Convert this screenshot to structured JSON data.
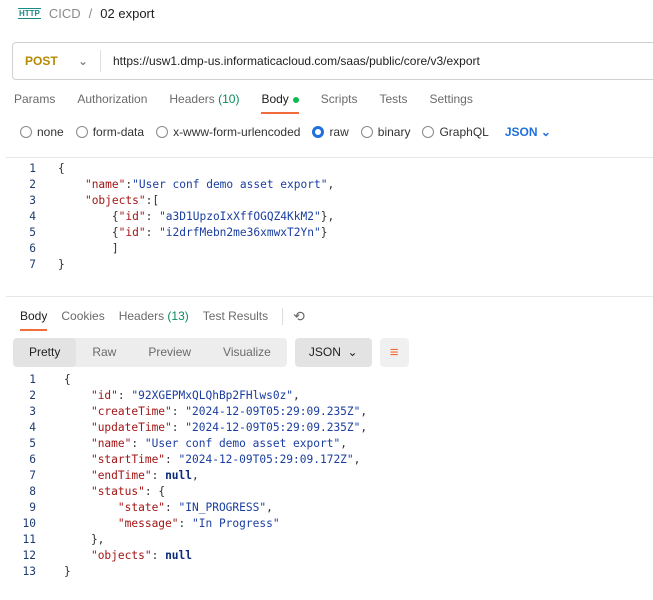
{
  "breadcrumb": {
    "icon": "HTTP",
    "parent": "CICD",
    "separator": "/",
    "current": "02 export"
  },
  "request": {
    "method": "POST",
    "url": "https://usw1.dmp-us.informaticacloud.com/saas/public/core/v3/export"
  },
  "tabs": [
    {
      "label": "Params"
    },
    {
      "label": "Authorization"
    },
    {
      "label": "Headers",
      "count": "(10)"
    },
    {
      "label": "Body"
    },
    {
      "label": "Scripts"
    },
    {
      "label": "Tests"
    },
    {
      "label": "Settings"
    }
  ],
  "body_types": [
    {
      "label": "none",
      "selected": false
    },
    {
      "label": "form-data",
      "selected": false
    },
    {
      "label": "x-www-form-urlencoded",
      "selected": false
    },
    {
      "label": "raw",
      "selected": true
    },
    {
      "label": "binary",
      "selected": false
    },
    {
      "label": "GraphQL",
      "selected": false
    }
  ],
  "body_format": "JSON",
  "request_body": [
    [
      [
        "pn",
        "{"
      ]
    ],
    [
      [
        "pn",
        "    "
      ],
      [
        "k",
        "\"name\""
      ],
      [
        "pn",
        ":"
      ],
      [
        "s",
        "\"User conf demo asset export\""
      ],
      [
        "pn",
        ","
      ]
    ],
    [
      [
        "pn",
        "    "
      ],
      [
        "k",
        "\"objects\""
      ],
      [
        "pn",
        ":["
      ]
    ],
    [
      [
        "pn",
        "        {"
      ],
      [
        "k",
        "\"id\""
      ],
      [
        "pn",
        ": "
      ],
      [
        "s",
        "\"a3D1UpzoIxXffOGQZ4KkM2\""
      ],
      [
        "pn",
        "},"
      ]
    ],
    [
      [
        "pn",
        "        {"
      ],
      [
        "k",
        "\"id\""
      ],
      [
        "pn",
        ": "
      ],
      [
        "s",
        "\"i2drfMebn2me36xmwxT2Yn\""
      ],
      [
        "pn",
        "}"
      ]
    ],
    [
      [
        "pn",
        "        ]"
      ]
    ],
    [
      [
        "pn",
        "}"
      ]
    ]
  ],
  "response_tabs": [
    {
      "label": "Body"
    },
    {
      "label": "Cookies"
    },
    {
      "label": "Headers",
      "count": "(13)"
    },
    {
      "label": "Test Results"
    }
  ],
  "view_modes": [
    "Pretty",
    "Raw",
    "Preview",
    "Visualize"
  ],
  "response_format": "JSON",
  "response_body": [
    [
      [
        "pn",
        "{"
      ]
    ],
    [
      [
        "pn",
        "    "
      ],
      [
        "k",
        "\"id\""
      ],
      [
        "pn",
        ": "
      ],
      [
        "s",
        "\"92XGEPMxQLQhBp2FHlws0z\""
      ],
      [
        "pn",
        ","
      ]
    ],
    [
      [
        "pn",
        "    "
      ],
      [
        "k",
        "\"createTime\""
      ],
      [
        "pn",
        ": "
      ],
      [
        "s",
        "\"2024-12-09T05:29:09.235Z\""
      ],
      [
        "pn",
        ","
      ]
    ],
    [
      [
        "pn",
        "    "
      ],
      [
        "k",
        "\"updateTime\""
      ],
      [
        "pn",
        ": "
      ],
      [
        "s",
        "\"2024-12-09T05:29:09.235Z\""
      ],
      [
        "pn",
        ","
      ]
    ],
    [
      [
        "pn",
        "    "
      ],
      [
        "k",
        "\"name\""
      ],
      [
        "pn",
        ": "
      ],
      [
        "s",
        "\"User conf demo asset export\""
      ],
      [
        "pn",
        ","
      ]
    ],
    [
      [
        "pn",
        "    "
      ],
      [
        "k",
        "\"startTime\""
      ],
      [
        "pn",
        ": "
      ],
      [
        "s",
        "\"2024-12-09T05:29:09.172Z\""
      ],
      [
        "pn",
        ","
      ]
    ],
    [
      [
        "pn",
        "    "
      ],
      [
        "k",
        "\"endTime\""
      ],
      [
        "pn",
        ": "
      ],
      [
        "n",
        "null"
      ],
      [
        "pn",
        ","
      ]
    ],
    [
      [
        "pn",
        "    "
      ],
      [
        "k",
        "\"status\""
      ],
      [
        "pn",
        ": {"
      ]
    ],
    [
      [
        "pn",
        "        "
      ],
      [
        "k",
        "\"state\""
      ],
      [
        "pn",
        ": "
      ],
      [
        "s",
        "\"IN_PROGRESS\""
      ],
      [
        "pn",
        ","
      ]
    ],
    [
      [
        "pn",
        "        "
      ],
      [
        "k",
        "\"message\""
      ],
      [
        "pn",
        ": "
      ],
      [
        "s",
        "\"In Progress\""
      ]
    ],
    [
      [
        "pn",
        "    },"
      ]
    ],
    [
      [
        "pn",
        "    "
      ],
      [
        "k",
        "\"objects\""
      ],
      [
        "pn",
        ": "
      ],
      [
        "n",
        "null"
      ]
    ],
    [
      [
        "pn",
        "}"
      ]
    ]
  ]
}
